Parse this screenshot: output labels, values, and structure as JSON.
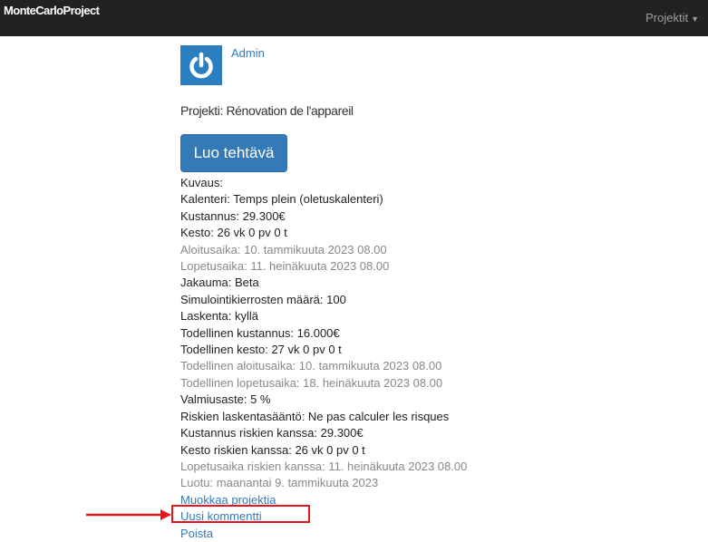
{
  "header": {
    "brand": "MonteCarloProject",
    "menu_label": "Projektit"
  },
  "user": {
    "name": "Admin"
  },
  "project_title": "Projekti: Rénovation de l'appareil",
  "create_task_label": "Luo tehtävä",
  "details": [
    {
      "text": "Kuvaus:",
      "muted": false
    },
    {
      "text": "Kalenteri: Temps plein (oletuskalenteri)",
      "muted": false
    },
    {
      "text": "Kustannus: 29.300€",
      "muted": false
    },
    {
      "text": "Kesto: 26 vk 0 pv 0 t",
      "muted": false
    },
    {
      "text": "Aloitusaika: 10. tammikuuta 2023 08.00",
      "muted": true
    },
    {
      "text": "Lopetusaika: 11. heinäkuuta 2023 08.00",
      "muted": true
    },
    {
      "text": "Jakauma: Beta",
      "muted": false
    },
    {
      "text": "Simulointikierrosten määrä: 100",
      "muted": false
    },
    {
      "text": "Laskenta: kyllä",
      "muted": false
    },
    {
      "text": "Todellinen kustannus: 16.000€",
      "muted": false
    },
    {
      "text": "Todellinen kesto: 27 vk 0 pv 0 t",
      "muted": false
    },
    {
      "text": "Todellinen aloitusaika: 10. tammikuuta 2023 08.00",
      "muted": true
    },
    {
      "text": "Todellinen lopetusaika: 18. heinäkuuta 2023 08.00",
      "muted": true
    },
    {
      "text": "Valmiusaste: 5 %",
      "muted": false
    },
    {
      "text": "Riskien laskentasääntö: Ne pas calculer les risques",
      "muted": false
    },
    {
      "text": "Kustannus riskien kanssa: 29.300€",
      "muted": false
    },
    {
      "text": "Kesto riskien kanssa: 26 vk 0 pv 0 t",
      "muted": false
    },
    {
      "text": "Lopetusaika riskien kanssa: 11. heinäkuuta 2023 08.00",
      "muted": true
    },
    {
      "text": "Luotu: maanantai 9. tammikuuta 2023",
      "muted": true
    }
  ],
  "links": {
    "edit": "Muokkaa projektia",
    "new_comment": "Uusi kommentti",
    "delete": "Poista"
  },
  "colors": {
    "navbar": "#222222",
    "link": "#337ab7",
    "button": "#337ab7",
    "highlight": "#e8141f"
  },
  "icons": {
    "avatar": "power-icon",
    "menu_caret": "caret-down-icon",
    "annotation_arrow": "arrow-right-icon"
  }
}
